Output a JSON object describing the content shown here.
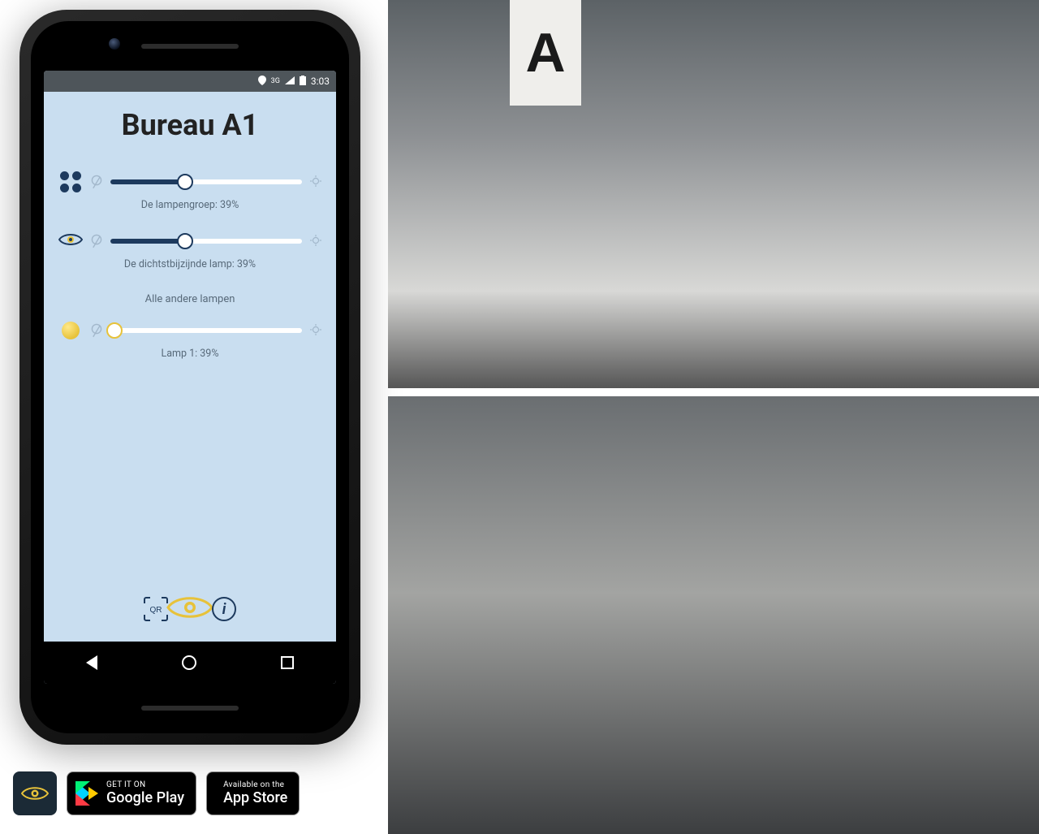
{
  "status_bar": {
    "network": "3G",
    "time": "3:03"
  },
  "app": {
    "title": "Bureau A1",
    "sliders": {
      "group": {
        "caption": "De lampengroep: 39%",
        "percent": 39
      },
      "nearest": {
        "caption": "De dichtstbijzijnde lamp: 39%",
        "percent": 39
      },
      "others_label": "Alle andere lampen",
      "lamp1": {
        "caption": "Lamp 1: 39%",
        "percent": 0
      }
    },
    "bottom_nav": {
      "qr_label": "QR"
    }
  },
  "badges": {
    "google_small": "GET IT ON",
    "google_big": "Google Play",
    "apple_small": "Available on the",
    "apple_big": "App Store"
  },
  "photos": {
    "zone_sign": "A"
  }
}
